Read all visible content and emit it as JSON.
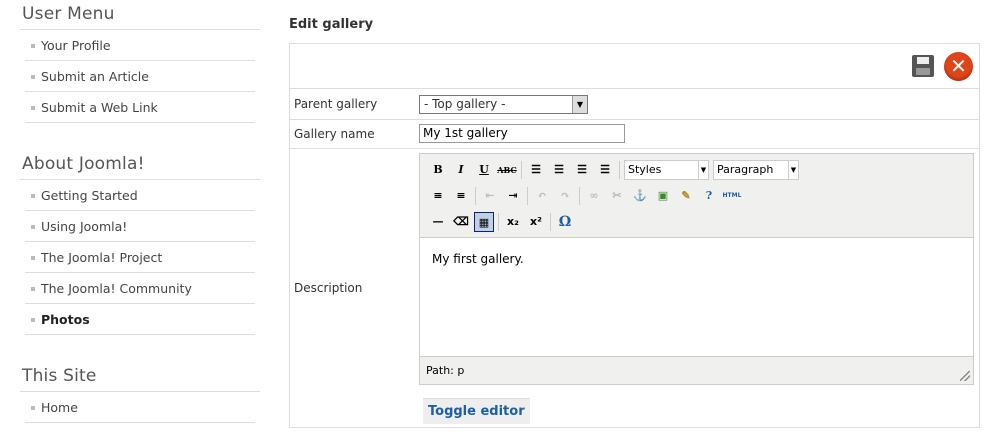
{
  "sidebar": {
    "modules": [
      {
        "title": "User Menu",
        "items": [
          "Your Profile",
          "Submit an Article",
          "Submit a Web Link"
        ]
      },
      {
        "title": "About Joomla!",
        "items": [
          "Getting Started",
          "Using Joomla!",
          "The Joomla! Project",
          "The Joomla! Community",
          "Photos"
        ]
      },
      {
        "title": "This Site",
        "items": [
          "Home"
        ]
      }
    ]
  },
  "main": {
    "heading": "Edit gallery",
    "form": {
      "parent_label": "Parent gallery",
      "parent_value": "- Top gallery -",
      "name_label": "Gallery name",
      "name_value": "My 1st gallery",
      "description_label": "Description",
      "editor": {
        "styles_select": "Styles",
        "format_select": "Paragraph",
        "content": "My first gallery.",
        "path": "Path: p",
        "html_button": "HTML"
      },
      "toggle_editor": "Toggle editor"
    }
  },
  "colors": {
    "accent": "#1c5ea8",
    "close": "#e0451a"
  }
}
